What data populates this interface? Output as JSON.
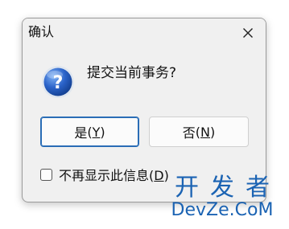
{
  "dialog": {
    "title": "确认",
    "message": "提交当前事务?",
    "buttons": {
      "yes_label": "是",
      "yes_mnemonic": "Y",
      "no_label": "否",
      "no_mnemonic": "N"
    },
    "checkbox": {
      "label": "不再显示此信息",
      "mnemonic": "D",
      "checked": false
    },
    "icons": {
      "close": "close-icon",
      "message": "question-icon"
    }
  },
  "watermark": {
    "line1": "开发者",
    "line2": "DevZe.CoM"
  },
  "colors": {
    "accent": "#2a6db6",
    "watermark": "#1b63b3",
    "dialog_bg": "#f0f0f0"
  }
}
